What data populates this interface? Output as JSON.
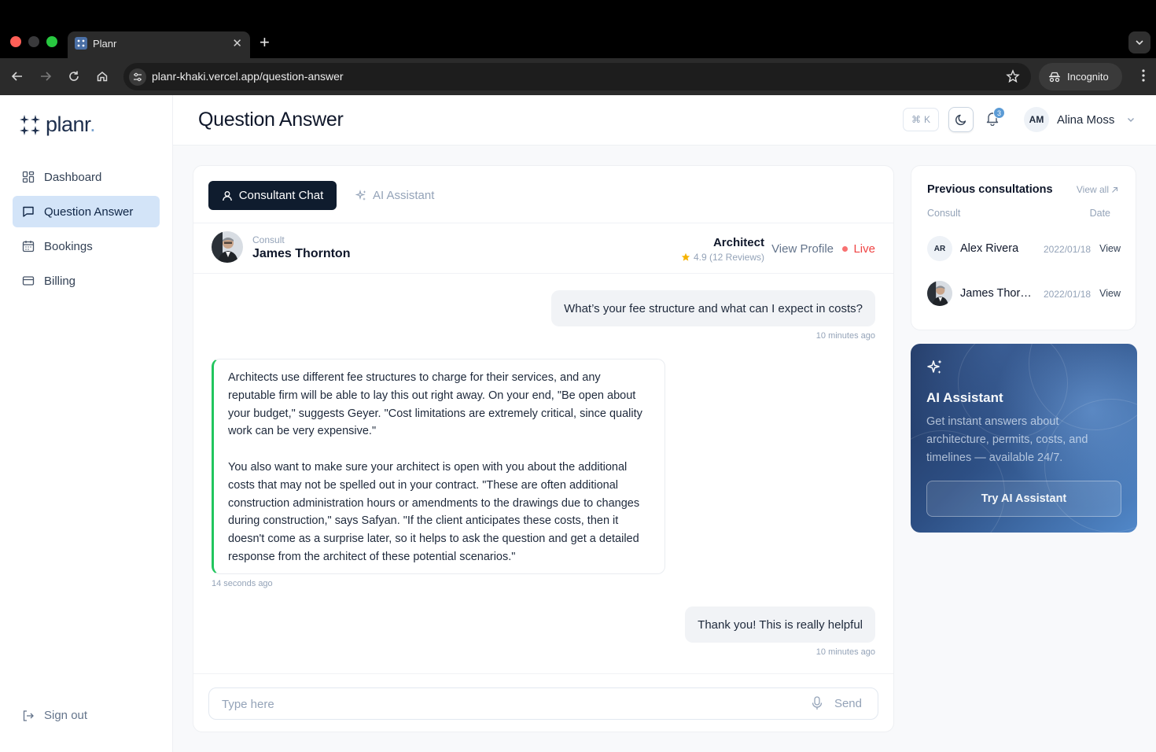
{
  "browser": {
    "tab_title": "Planr",
    "url": "planr-khaki.vercel.app/question-answer",
    "incognito_label": "Incognito"
  },
  "sidebar": {
    "logo_text": "planr",
    "logo_dot": ".",
    "items": [
      {
        "label": "Dashboard",
        "icon": "grid-icon",
        "active": false
      },
      {
        "label": "Question Answer",
        "icon": "chat-icon",
        "active": true
      },
      {
        "label": "Bookings",
        "icon": "calendar-icon",
        "active": false
      },
      {
        "label": "Billing",
        "icon": "card-icon",
        "active": false
      }
    ],
    "signout_label": "Sign out"
  },
  "header": {
    "page_title": "Question Answer",
    "shortcut_symbol": "⌘",
    "shortcut_key": "K",
    "notification_count": "3",
    "user_initials": "AM",
    "user_name": "Alina Moss"
  },
  "chat": {
    "tabs": {
      "consultant": "Consultant Chat",
      "ai": "AI Assistant"
    },
    "consultant": {
      "label": "Consult",
      "name": "James Thornton",
      "role": "Architect",
      "rating": "4.9 (12 Reviews)",
      "view_profile": "View Profile",
      "status": "Live"
    },
    "messages": [
      {
        "from": "user",
        "text": "What’s your fee structure and what can I expect in costs?",
        "time": "10 minutes ago"
      },
      {
        "from": "consultant",
        "paragraphs": [
          "Architects use different fee structures to charge for their services, and any reputable firm will be able to lay this out right away. On your end, \"Be open about your budget,\" suggests Geyer. \"Cost limitations are extremely critical, since quality work can be very expensive.\"",
          "You also want to make sure your architect is open with you about the additional costs that may not be spelled out in your contract. \"These are often additional construction administration hours or amendments to the drawings due to changes during construction,\" says Safyan. \"If the client anticipates these costs, then it doesn't come as a surprise later, so it helps to ask the question and get a detailed response from the architect of these potential scenarios.\""
        ],
        "time": "14 seconds ago"
      },
      {
        "from": "user",
        "text": "Thank you! This is really helpful",
        "time": "10 minutes ago"
      }
    ],
    "composer": {
      "placeholder": "Type here",
      "send": "Send"
    }
  },
  "previous": {
    "title": "Previous consultations",
    "view_all": "View all",
    "col_consult": "Consult",
    "col_date": "Date",
    "rows": [
      {
        "initials": "AR",
        "name": "Alex Rivera",
        "date": "2022/01/18",
        "action": "View"
      },
      {
        "initials": "",
        "name": "James Thornton",
        "date": "2022/01/18",
        "action": "View"
      }
    ]
  },
  "ai_promo": {
    "title": "AI Assistant",
    "description": "Get instant answers about architecture, permits, costs, and timelines — available 24/7.",
    "button": "Try AI Assistant"
  },
  "colors": {
    "accent_dark": "#0f1c2e",
    "active_nav": "#d3e4f8",
    "live": "#ef4444",
    "message_bar": "#22c55e"
  }
}
